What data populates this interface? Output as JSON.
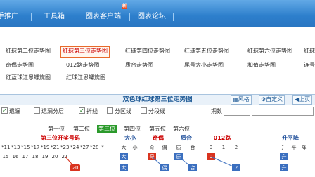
{
  "nav": {
    "items": [
      "手推广",
      "工具箱",
      "图表客户端",
      "图表论坛"
    ],
    "badge": "新"
  },
  "links": {
    "row1": [
      "红球第二位走势图",
      "红球第三位走势图",
      "红球第四位走势图",
      "红球第五位走势图",
      "红球第六位走势图",
      "红球"
    ],
    "row2": [
      "奇偶走势图",
      "012路走势图",
      "质合走势图",
      "尾号大小走势图",
      "和值走势图",
      "连号"
    ],
    "row3": [
      "红蓝球江恩螺旋图",
      "红球江恩螺旋图"
    ]
  },
  "panel": {
    "title": "双色球红球第三位走势图",
    "btn_style": "风格",
    "btn_custom": "自定义",
    "btn_prev": "上页"
  },
  "options": {
    "items": [
      "遗漏",
      "遗漏分层",
      "折线",
      "分区线",
      "分段线"
    ],
    "checked": [
      true,
      false,
      true,
      false,
      false
    ],
    "period_label": "期数"
  },
  "positions": [
    "第一位",
    "第二位",
    "第三位",
    "第四位",
    "第五位",
    "第六位"
  ],
  "active_position": "第三位",
  "table": {
    "groups": [
      "第三位开奖号码",
      "大小",
      "奇偶",
      "质合",
      "012路",
      "升平降"
    ],
    "subheads": [
      "*11",
      "*13",
      "*15",
      "*17",
      "*19",
      "*21",
      "*23",
      "*24",
      "*27",
      "*28",
      "*",
      "大",
      "小",
      "奇",
      "偶",
      "质",
      "合",
      "0",
      "1",
      "2",
      "升",
      "平",
      "降"
    ],
    "row1": [
      "15",
      "16",
      "17",
      "18",
      "19",
      "20",
      "21",
      "大",
      "奇",
      "质",
      "0",
      "升"
    ],
    "row2": [
      "20",
      "大",
      "偶",
      "合",
      "2",
      "升"
    ]
  }
}
